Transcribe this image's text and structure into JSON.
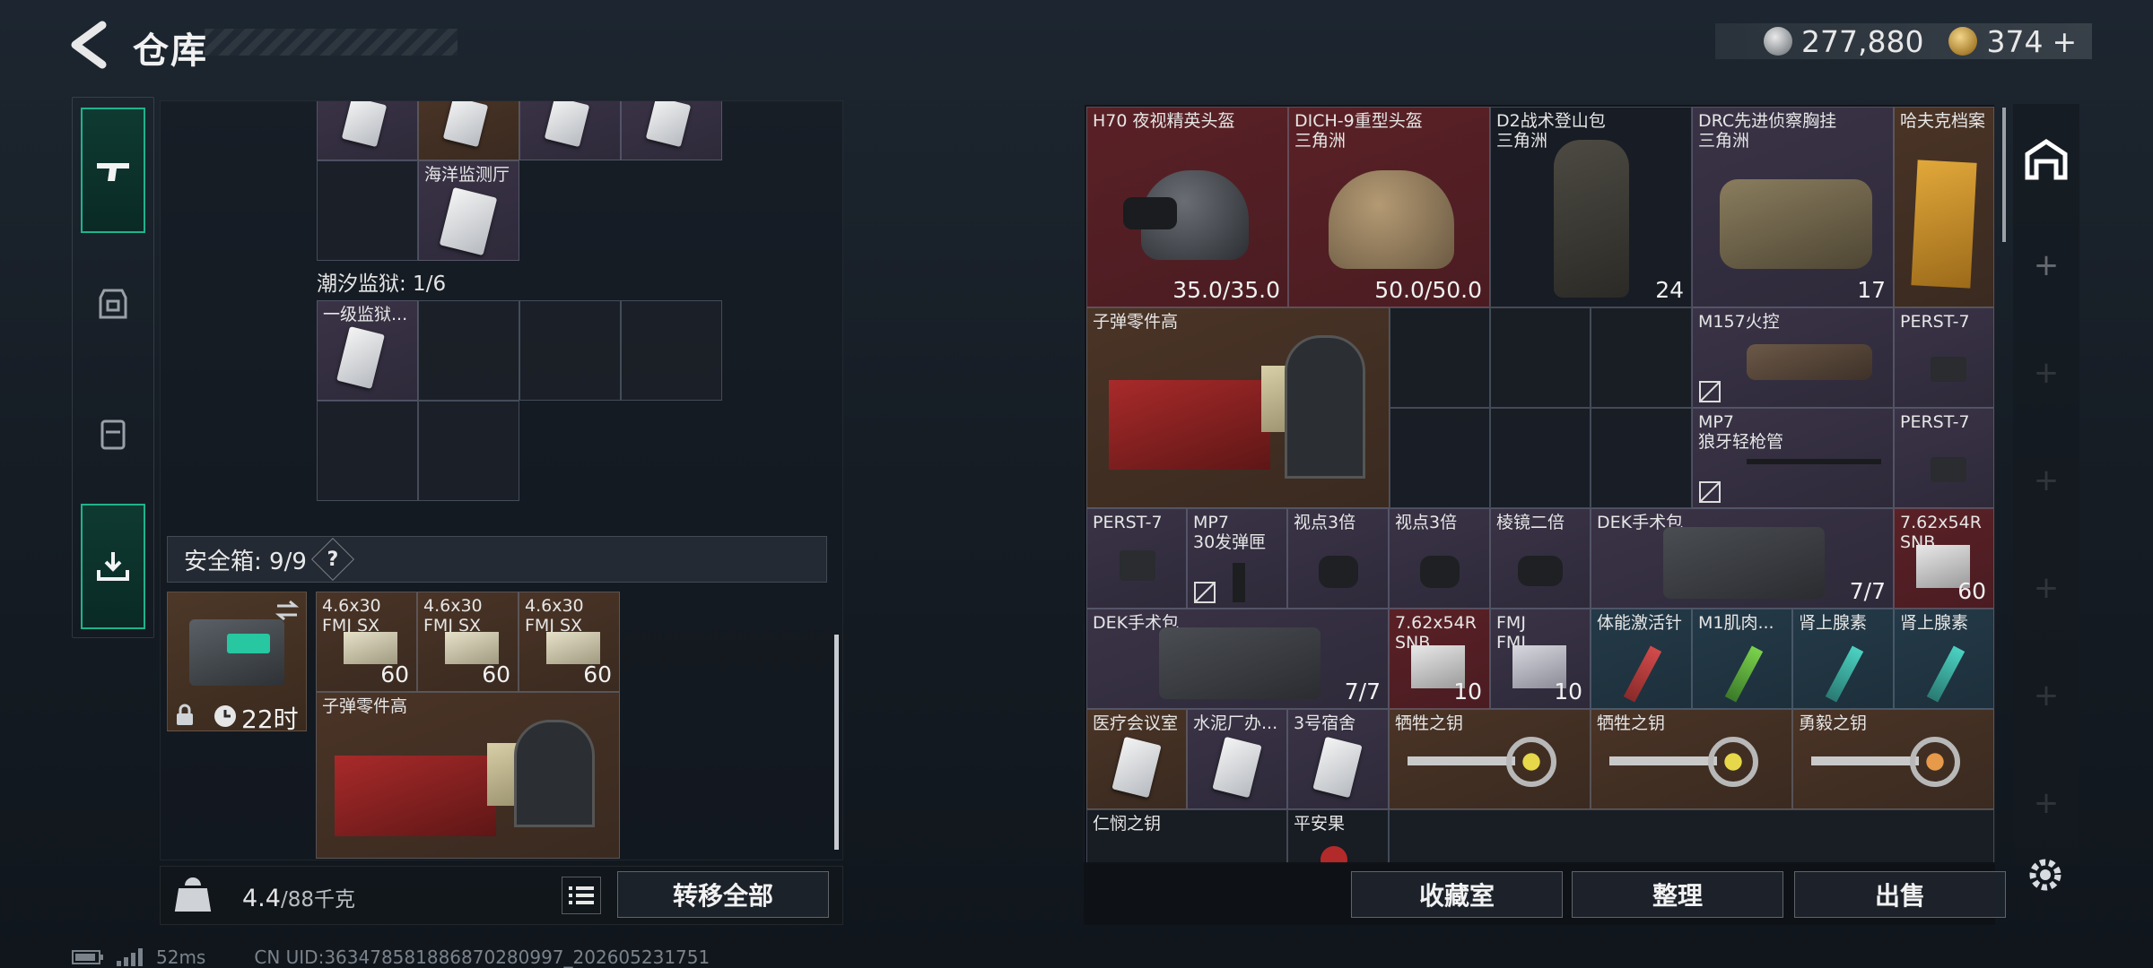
{
  "header": {
    "title": "仓库",
    "currency_silver": "277,880",
    "currency_gold": "374",
    "gold_add": "+"
  },
  "left": {
    "prison_section": "潮汐监狱: 1/6",
    "ocean_label": "海洋监测厅",
    "prison_item": "一级监狱...",
    "safe_label": "安全箱: 9/9",
    "safe_help": "?",
    "safe_timer": "22时",
    "ammo": [
      {
        "name": "4.6x30 FMJ SX",
        "count": "60"
      },
      {
        "name": "4.6x30 FMJ SX",
        "count": "60"
      },
      {
        "name": "4.6x30 FMJ SX",
        "count": "60"
      }
    ],
    "parts_label": "子弹零件高",
    "weight": "4.4",
    "weight_max": "/88千克",
    "transfer": "转移全部"
  },
  "right": {
    "row1": [
      {
        "name": "H70 夜视精英头盔",
        "value": "35.0/35.0"
      },
      {
        "name": "DICH-9重型头盔",
        "sub": "三角洲",
        "value": "50.0/50.0"
      },
      {
        "name": "D2战术登山包",
        "sub": "三角洲",
        "value": "24"
      },
      {
        "name": "DRC先进侦察胸挂",
        "sub": "三角洲",
        "value": "17"
      },
      {
        "name": "哈夫克档案"
      }
    ],
    "parts": "子弹零件高",
    "m157": "M157火控",
    "perst_a": "PERST-7",
    "mp7": "MP7",
    "mp7_sub": "狼牙轻枪管",
    "perst_b": "PERST-7",
    "row3": [
      {
        "name": "PERST-7"
      },
      {
        "name": "MP7",
        "sub": "30发弹匣"
      },
      {
        "name": "视点3倍"
      },
      {
        "name": "视点3倍"
      },
      {
        "name": "棱镜二倍"
      }
    ],
    "dek1": "DEK手术包",
    "dek1_val": "7/7",
    "rifle1": "7.62x54R SNB",
    "rifle1_val": "60",
    "dek2": "DEK手术包",
    "dek2_val": "7/7",
    "rifle2": "7.62x54R SNB",
    "rifle2_val": "10",
    "fmj": "FMJ FMJ",
    "fmj_val": "10",
    "inj": [
      "体能激活针",
      "M1肌肉...",
      "肾上腺素",
      "肾上腺素"
    ],
    "row5": [
      "医疗会议室",
      "水泥厂办...",
      "3号宿舍"
    ],
    "keys": [
      "牺牲之钥",
      "牺牲之钥",
      "勇毅之钥"
    ],
    "row6": [
      "仁悯之钥",
      "平安果"
    ],
    "buttons": {
      "collect": "收藏室",
      "sort": "整理",
      "sell": "出售"
    }
  },
  "status": {
    "ping": "52ms",
    "uid": "CN UID:363478581886870280997_202605231751"
  },
  "colors": {
    "accent": "#1fb38c",
    "red_cell": "#5a2126",
    "brown_cell": "#4a3426",
    "blue_cell": "#243a48"
  }
}
